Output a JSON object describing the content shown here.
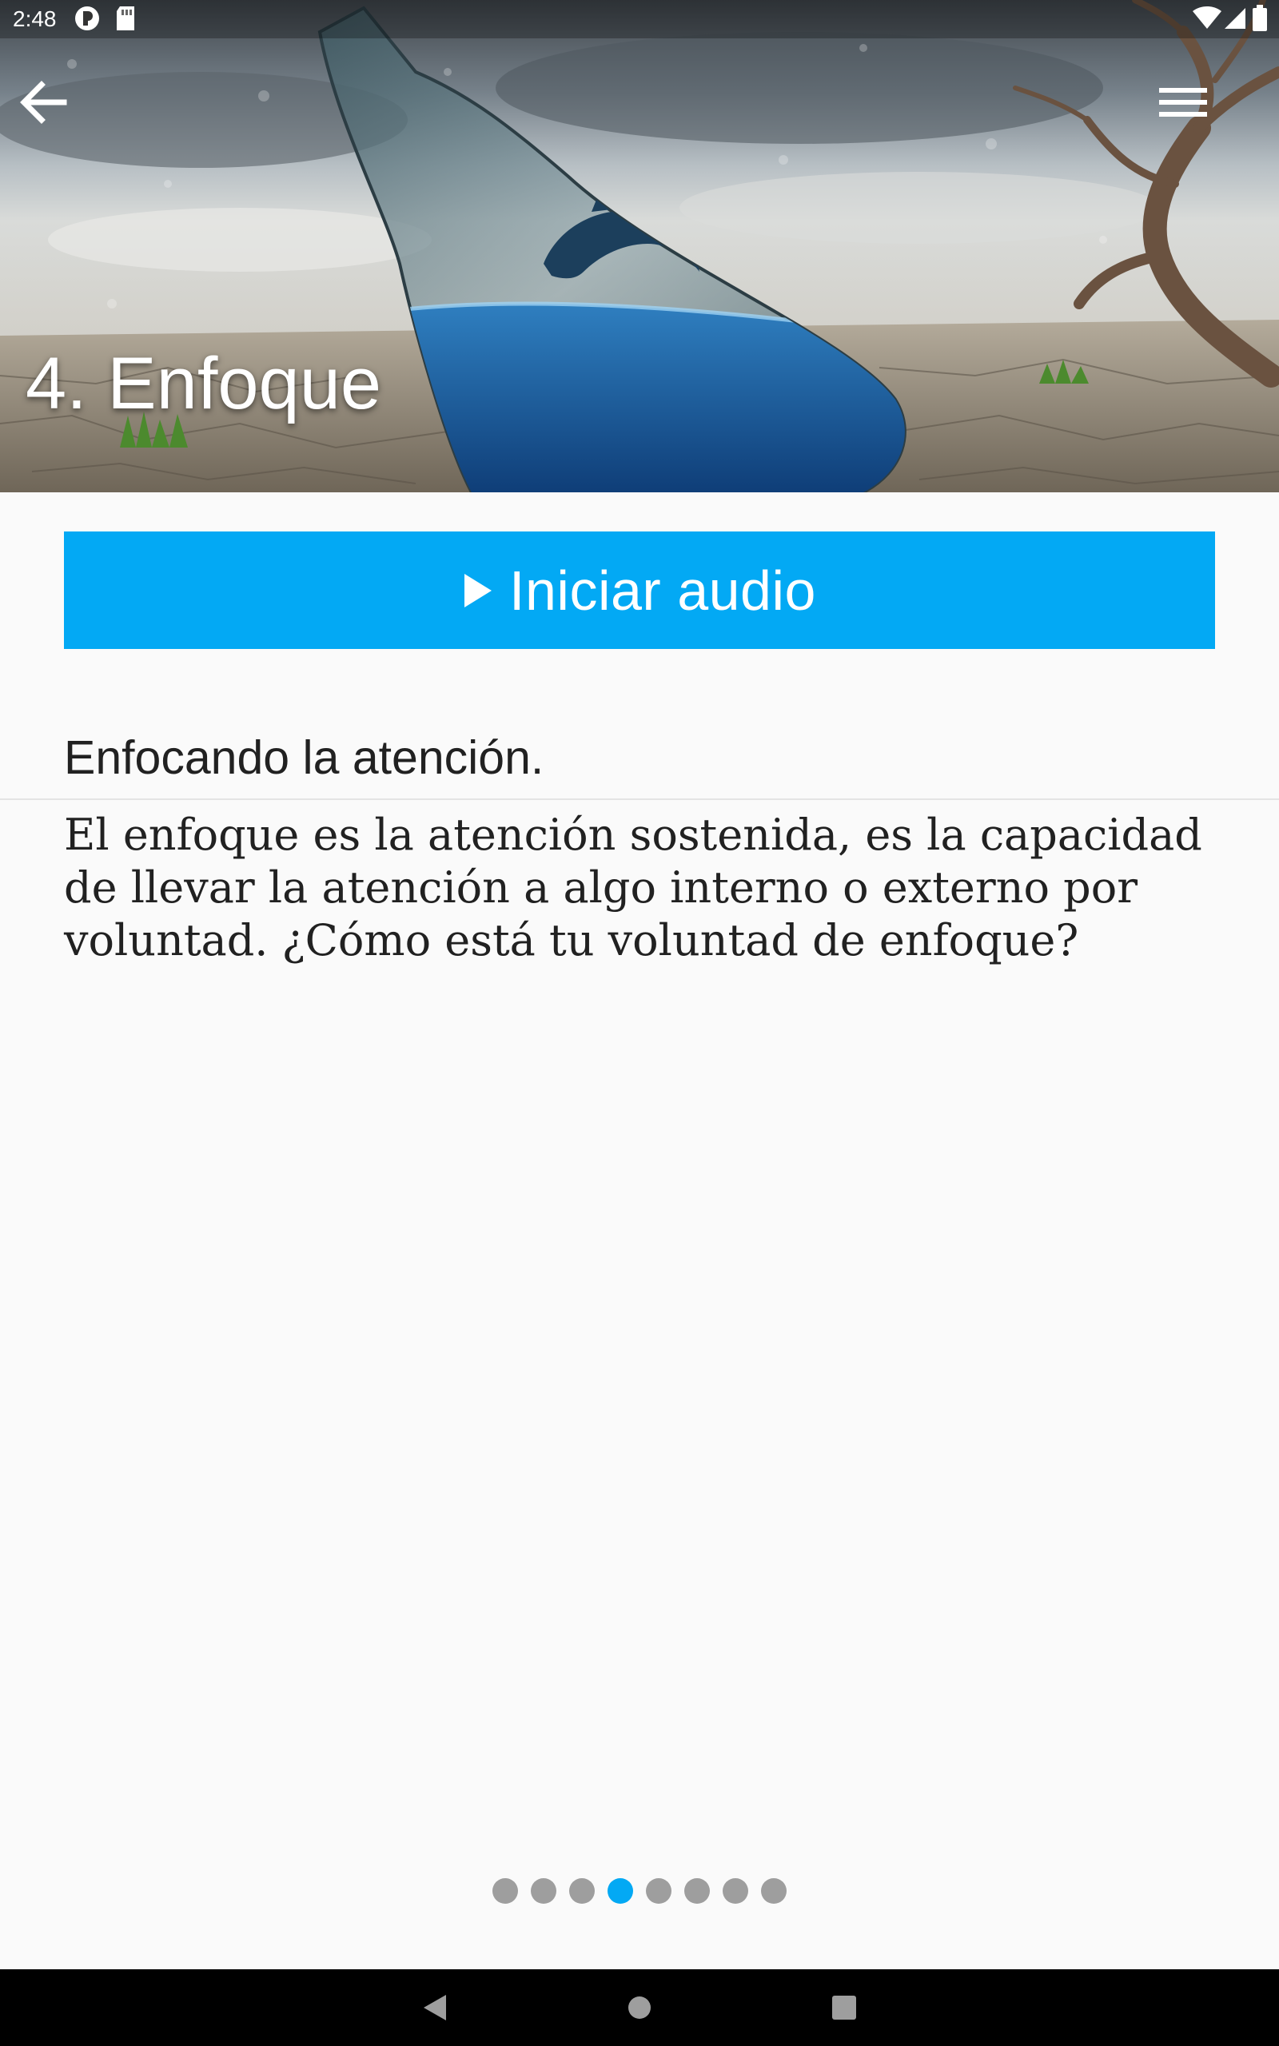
{
  "status_bar": {
    "time": "2:48",
    "icons": [
      "notification-app-icon",
      "sd-card-icon",
      "wifi-icon",
      "signal-icon",
      "battery-icon"
    ]
  },
  "toolbar": {
    "back_icon": "arrow-back-icon",
    "menu_icon": "hamburger-menu-icon"
  },
  "header": {
    "title": "4. Enfoque",
    "image": "surreal-bottle-with-dolphin-in-desert"
  },
  "audio_button": {
    "label": "Iniciar audio",
    "icon": "play-icon",
    "color": "#03a9f4"
  },
  "content": {
    "subtitle": "Enfocando la atención.",
    "body": "El enfoque es la atención sostenida, es la capacidad de llevar la atención a algo interno o externo por voluntad. ¿Cómo está tu voluntad de enfoque?"
  },
  "pager": {
    "total": 8,
    "current": 4,
    "active_color": "#03a9f4",
    "inactive_color": "#9e9e9e"
  },
  "nav_bar": {
    "buttons": [
      "back-triangle-icon",
      "home-circle-icon",
      "recents-square-icon"
    ]
  }
}
